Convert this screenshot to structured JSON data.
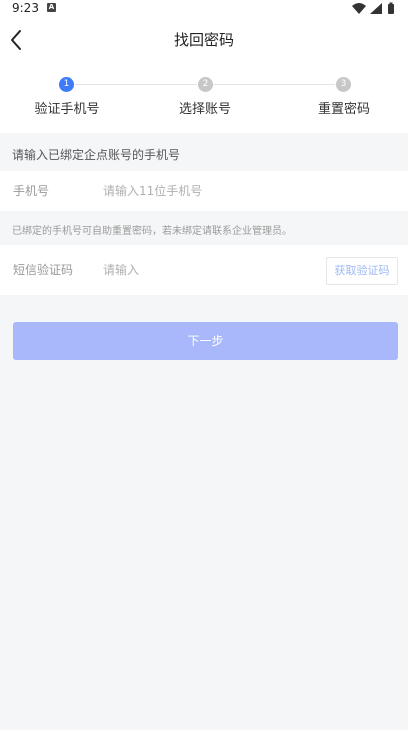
{
  "status_bar": {
    "time": "9:23",
    "notification_badge": "A",
    "icons": [
      "wifi-icon",
      "signal-icon",
      "battery-icon"
    ]
  },
  "nav": {
    "title": "找回密码",
    "back_icon": "chevron-left-icon"
  },
  "steps": [
    {
      "number": "1",
      "label": "验证手机号",
      "active": true
    },
    {
      "number": "2",
      "label": "选择账号",
      "active": false
    },
    {
      "number": "3",
      "label": "重置密码",
      "active": false
    }
  ],
  "form": {
    "section_hint": "请输入已绑定企点账号的手机号",
    "phone": {
      "label": "手机号",
      "placeholder": "请输入11位手机号",
      "value": ""
    },
    "phone_hint": "已绑定的手机号可自助重置密码，若未绑定请联系企业管理员。",
    "sms": {
      "label": "短信验证码",
      "placeholder": "请输入",
      "value": "",
      "get_code_label": "获取验证码"
    },
    "next_label": "下一步"
  },
  "colors": {
    "accent": "#3d7bfa",
    "button_disabled": "#a8b8fb",
    "background": "#f5f6f8"
  }
}
